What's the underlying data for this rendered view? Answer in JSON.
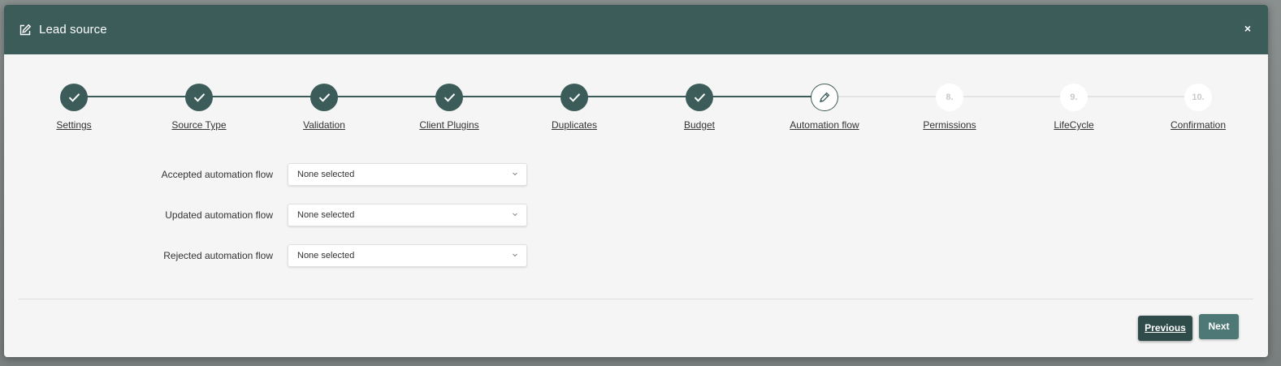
{
  "modal": {
    "title": "Lead source",
    "header_icon": "edit-icon",
    "close_label": "×"
  },
  "stepper": {
    "steps": [
      {
        "label": "Settings",
        "state": "done",
        "icon": "check-icon"
      },
      {
        "label": "Source Type",
        "state": "done",
        "icon": "check-icon"
      },
      {
        "label": "Validation",
        "state": "done",
        "icon": "check-icon"
      },
      {
        "label": "Client Plugins",
        "state": "done",
        "icon": "check-icon"
      },
      {
        "label": "Duplicates",
        "state": "done",
        "icon": "check-icon"
      },
      {
        "label": "Budget",
        "state": "done",
        "icon": "check-icon"
      },
      {
        "label": "Automation flow",
        "state": "current",
        "icon": "pencil-icon"
      },
      {
        "label": "Permissions",
        "state": "todo",
        "number": "8."
      },
      {
        "label": "LifeCycle",
        "state": "todo",
        "number": "9."
      },
      {
        "label": "Confirmation",
        "state": "todo",
        "number": "10."
      }
    ]
  },
  "form": {
    "accepted": {
      "label": "Accepted automation flow",
      "value": "None selected"
    },
    "updated": {
      "label": "Updated automation flow",
      "value": "None selected"
    },
    "rejected": {
      "label": "Rejected automation flow",
      "value": "None selected"
    }
  },
  "footer": {
    "previous_label": "Previous",
    "next_label": "Next"
  },
  "colors": {
    "header": "#3c5c5a",
    "step_done": "#3c5c5a",
    "previous_button": "#2f4c4a",
    "next_button": "#4d7876"
  }
}
